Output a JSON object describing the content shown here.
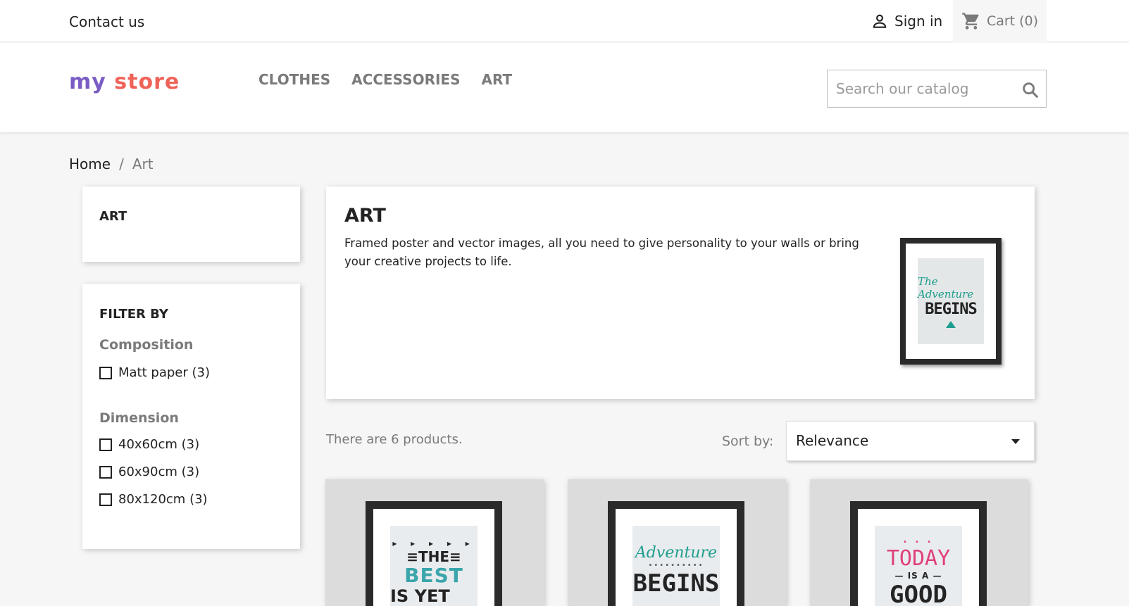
{
  "topbar": {
    "contact_label": "Contact us",
    "signin_label": "Sign in",
    "cart_label": "Cart (0)"
  },
  "header": {
    "logo": {
      "part1": "my",
      "part2": "store"
    },
    "menu": [
      "CLOTHES",
      "ACCESSORIES",
      "ART"
    ],
    "search_placeholder": "Search our catalog"
  },
  "breadcrumb": {
    "home": "Home",
    "separator": "/",
    "current": "Art"
  },
  "sidebar": {
    "category_title": "ART",
    "filter_title": "FILTER BY",
    "facets": [
      {
        "title": "Composition",
        "options": [
          "Matt paper (3)"
        ]
      },
      {
        "title": "Dimension",
        "options": [
          "40x60cm (3)",
          "60x90cm (3)",
          "80x120cm (3)"
        ]
      }
    ]
  },
  "category": {
    "title": "ART",
    "description": "Framed poster and vector images, all you need to give personality to your walls or bring your creative projects to life.",
    "cover_image": {
      "line1": "The Adventure",
      "line2": "BEGINS"
    }
  },
  "listing": {
    "count_text": "There are 6 products.",
    "sort_label": "Sort by:",
    "sort_value": "Relevance"
  },
  "products": [
    {
      "art": {
        "a": "▸ ▸ ▸ ▸ ▸",
        "b": "≡THE≡",
        "c": "BEST",
        "d": "IS YET TO"
      }
    },
    {
      "art": {
        "a": "Adventure",
        "b": "••••••••••",
        "c": "BEGINS"
      }
    },
    {
      "art": {
        "a": "• • •",
        "b": "TODAY",
        "c": "— IS A —",
        "d": "GOOD"
      }
    }
  ],
  "colors": {
    "accent": "#2fb5d2",
    "text": "#232323",
    "muted": "#7a7a7a",
    "background": "#f6f6f6"
  }
}
